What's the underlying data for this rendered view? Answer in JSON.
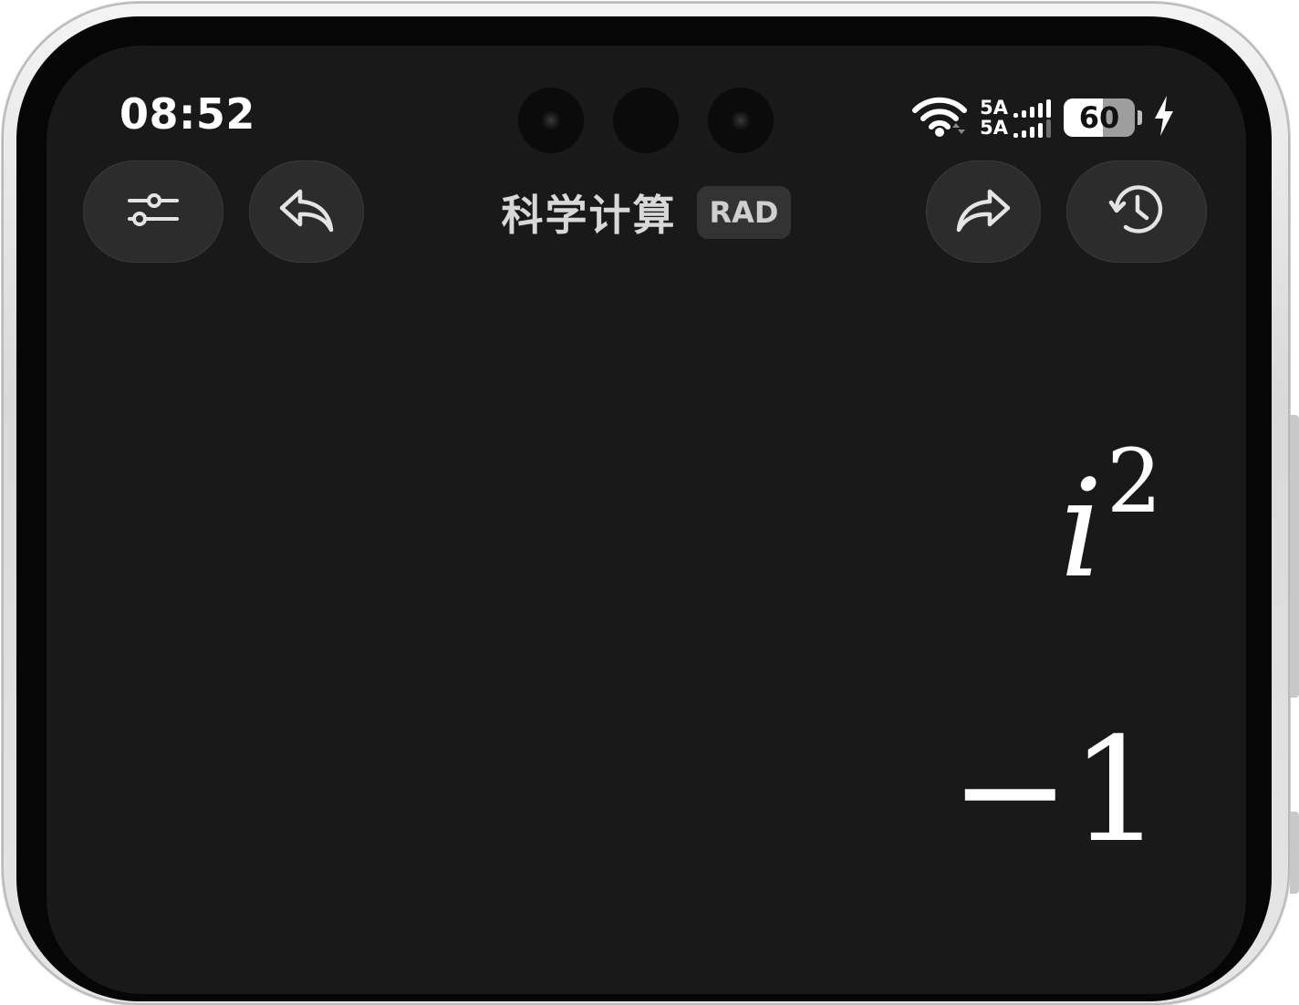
{
  "status_bar": {
    "time": "08:52",
    "network_1": "5A",
    "network_2": "5A",
    "battery_level": "60",
    "icons": [
      "wifi-icon",
      "signal-bars-icon",
      "battery-icon",
      "charging-bolt-icon"
    ]
  },
  "toolbar": {
    "title": "科学计算",
    "angle_mode": "RAD",
    "buttons": [
      "settings-sliders-icon",
      "undo-icon",
      "redo-icon",
      "history-clock-icon"
    ]
  },
  "display": {
    "expression_base": "i",
    "expression_exponent": "2",
    "result": "−1"
  },
  "colors": {
    "screen_background": "#191919",
    "button_background": "#2c2c2c",
    "text_primary": "#ffffff",
    "badge_background": "#333333"
  }
}
